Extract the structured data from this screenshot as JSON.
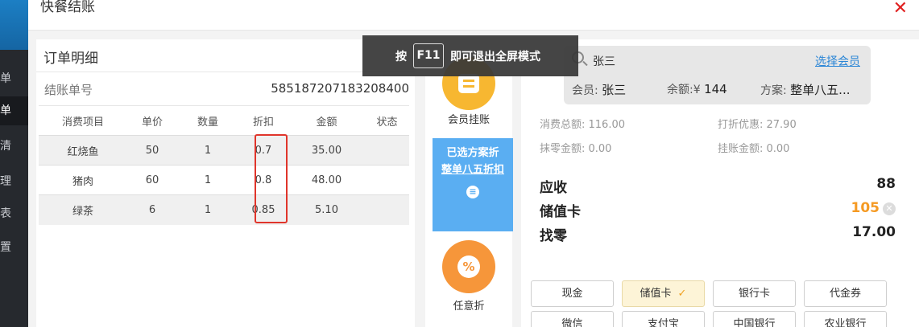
{
  "background": {
    "sidebar_items": [
      "单",
      "单",
      "清",
      "理",
      "表",
      "置"
    ]
  },
  "modal": {
    "title": "快餐结账",
    "close_icon": "close-icon"
  },
  "order": {
    "title": "订单明细",
    "bill_label": "结账单号",
    "bill_no": "585187207183208400",
    "columns": [
      "消费项目",
      "单价",
      "数量",
      "折扣",
      "金额",
      "状态"
    ],
    "rows": [
      [
        "红烧鱼",
        "50",
        "1",
        "0.7",
        "35.00",
        ""
      ],
      [
        "猪肉",
        "60",
        "1",
        "0.8",
        "48.00",
        ""
      ],
      [
        "绿茶",
        "6",
        "1",
        "0.85",
        "5.10",
        ""
      ]
    ]
  },
  "actions": {
    "member_charge_label": "会员挂账",
    "selected_plan_line1": "已选方案折",
    "selected_plan_line2": "整单八五折扣",
    "any_discount_label": "任意折",
    "any_discount_icon": "%"
  },
  "member": {
    "search_value": "张三",
    "select_member_link": "选择会员",
    "member_label": "会员:",
    "member_name": "张三",
    "balance_label": "余额:¥",
    "balance_value": "144",
    "plan_label": "方案:",
    "plan_value": "整单八五..."
  },
  "summary": {
    "total_consumption": "消费总额: 116.00",
    "discount_benefit": "打折优惠: 27.90",
    "round_off": "抹零金额: 0.00",
    "on_account": "挂账金额: 0.00"
  },
  "totals": {
    "receivable_label": "应收",
    "receivable_value": "88",
    "stored_card_label": "储值卡",
    "stored_card_value": "105",
    "change_label": "找零",
    "change_value": "17.00"
  },
  "payment_methods": [
    "现金",
    "储值卡",
    "银行卡",
    "代金券",
    "微信",
    "支付宝",
    "中国银行",
    "农业银行"
  ],
  "selected_payment": "储值卡",
  "toast": {
    "prefix": "按",
    "key": "F11",
    "suffix": "即可退出全屏模式"
  },
  "colors": {
    "accent_orange": "#f59a23",
    "highlight_red": "#e0352b",
    "plan_blue": "#5aaef2",
    "link_blue": "#2b86d6"
  }
}
